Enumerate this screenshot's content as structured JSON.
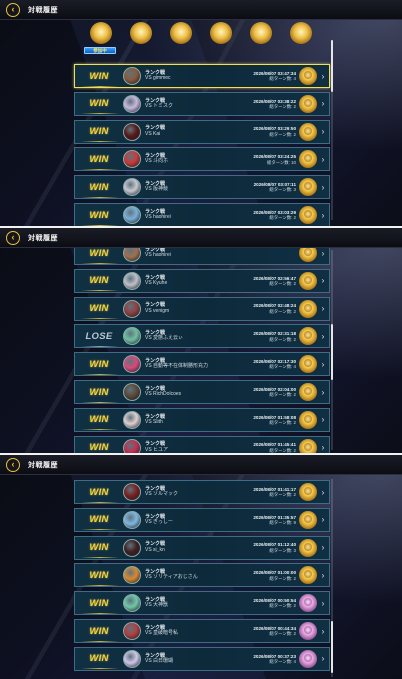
{
  "header": {
    "title": "対戦履歴"
  },
  "top_badge": "参加中",
  "panels": [
    {
      "rows": [
        {
          "result": "WIN",
          "mode": "ランク戦",
          "opponent": "VS gimmec",
          "datetime": "2026/08/07 03:47:34",
          "turns": "総ターン数: 4",
          "avatar_color": "#8a5a3a",
          "medal": "gold",
          "selected": true
        },
        {
          "result": "WIN",
          "mode": "ランク戦",
          "opponent": "VS トミスク",
          "datetime": "2026/08/07 03:38:22",
          "turns": "総ターン数: 2",
          "avatar_color": "#c8b8e0",
          "medal": "gold",
          "selected": false
        },
        {
          "result": "WIN",
          "mode": "ランク戦",
          "opponent": "VS Kai",
          "datetime": "2026/08/07 03:29:50",
          "turns": "総ターン数: 2",
          "avatar_color": "#5a1818",
          "medal": "gold",
          "selected": false
        },
        {
          "result": "WIN",
          "mode": "ランク戦",
          "opponent": "VS 斗向ホ",
          "datetime": "2026/08/07 03:24:25",
          "turns": "総ターン数: 10",
          "avatar_color": "#c83a3a",
          "medal": "gold",
          "selected": false
        },
        {
          "result": "WIN",
          "mode": "ランク戦",
          "opponent": "VS 阪神競",
          "datetime": "2026/08/07 03:07:11",
          "turns": "総ターン数: 3",
          "avatar_color": "#c8c8d0",
          "medal": "gold",
          "selected": false
        },
        {
          "result": "WIN",
          "mode": "ランク戦",
          "opponent": "VS haohirei",
          "datetime": "2026/08/07 03:03:29",
          "turns": "総ターン数: 2",
          "avatar_color": "#7ab0d8",
          "medal": "gold",
          "selected": false
        }
      ]
    },
    {
      "rows": [
        {
          "result": "WIN",
          "mode": "ランク戦",
          "opponent": "VS haohirei",
          "datetime": "",
          "turns": "",
          "avatar_color": "#a07050",
          "medal": "gold",
          "selected": false
        },
        {
          "result": "WIN",
          "mode": "ランク戦",
          "opponent": "VS Kyuhe",
          "datetime": "2026/08/07 02:56:47",
          "turns": "総ターン数: 2",
          "avatar_color": "#c0c0c8",
          "medal": "gold",
          "selected": false
        },
        {
          "result": "WIN",
          "mode": "ランク戦",
          "opponent": "VS venigm",
          "datetime": "2026/08/07 02:48:24",
          "turns": "総ターン数: 2",
          "avatar_color": "#904040",
          "medal": "gold",
          "selected": false
        },
        {
          "result": "LOSE",
          "mode": "ランク戦",
          "opponent": "VS 変態ふえ云ぃ",
          "datetime": "2026/08/07 02:31:18",
          "turns": "総ターン数: 2",
          "avatar_color": "#70c0a0",
          "medal": "gold",
          "selected": false
        },
        {
          "result": "WIN",
          "mode": "ランク戦",
          "opponent": "VS 自動等不在体制勝形充力",
          "datetime": "2026/08/07 02:17:30",
          "turns": "総ターン数: 4",
          "avatar_color": "#d84a7a",
          "medal": "gold",
          "selected": false
        },
        {
          "result": "WIN",
          "mode": "ランク戦",
          "opponent": "VS RichDolcoes",
          "datetime": "2026/08/07 02:04:00",
          "turns": "総ターン数: 2",
          "avatar_color": "#5a4a3a",
          "medal": "gold",
          "selected": false
        },
        {
          "result": "WIN",
          "mode": "ランク戦",
          "opponent": "VS Slith",
          "datetime": "2026/08/07 01:58:08",
          "turns": "総ターン数: 2",
          "avatar_color": "#e0d0d0",
          "medal": "gold",
          "selected": false
        },
        {
          "result": "WIN",
          "mode": "ランク戦",
          "opponent": "VS ヒユア",
          "datetime": "2026/08/07 01:45:41",
          "turns": "総ターン数: 2",
          "avatar_color": "#c03050",
          "medal": "gold",
          "selected": false
        }
      ]
    },
    {
      "rows": [
        {
          "result": "WIN",
          "mode": "ランク戦",
          "opponent": "VS ソルマック",
          "datetime": "2026/08/07 01:41:17",
          "turns": "総ターン数: 2",
          "avatar_color": "#7a2020",
          "medal": "gold",
          "selected": false
        },
        {
          "result": "WIN",
          "mode": "ランク戦",
          "opponent": "VS ぎっしー",
          "datetime": "2026/08/07 01:35:57",
          "turns": "総ターン数: 9",
          "avatar_color": "#80b8e0",
          "medal": "gold",
          "selected": false
        },
        {
          "result": "WIN",
          "mode": "ランク戦",
          "opponent": "VS si_kn",
          "datetime": "2026/08/07 01:12:40",
          "turns": "総ターン数: 3",
          "avatar_color": "#402020",
          "medal": "gold",
          "selected": false
        },
        {
          "result": "WIN",
          "mode": "ランク戦",
          "opponent": "VS ソリティアおじさん",
          "datetime": "2026/08/07 01:00:00",
          "turns": "総ターン数: 2",
          "avatar_color": "#d88a30",
          "medal": "gold",
          "selected": false
        },
        {
          "result": "WIN",
          "mode": "ランク戦",
          "opponent": "VS 大神獣",
          "datetime": "2026/08/07 00:50:54",
          "turns": "総ターン数: 2",
          "avatar_color": "#70c8a8",
          "medal": "pink",
          "selected": false
        },
        {
          "result": "WIN",
          "mode": "ランク戦",
          "opponent": "VS 皇破暗号私",
          "datetime": "2026/08/07 00:44:34",
          "turns": "総ターン数: 2",
          "avatar_color": "#b04040",
          "medal": "pink",
          "selected": false
        },
        {
          "result": "WIN",
          "mode": "ランク戦",
          "opponent": "VS 白日珊瑚",
          "datetime": "2026/08/07 00:37:23",
          "turns": "総ターン数: 4",
          "avatar_color": "#d0c8e8",
          "medal": "pink",
          "selected": false
        }
      ]
    }
  ]
}
